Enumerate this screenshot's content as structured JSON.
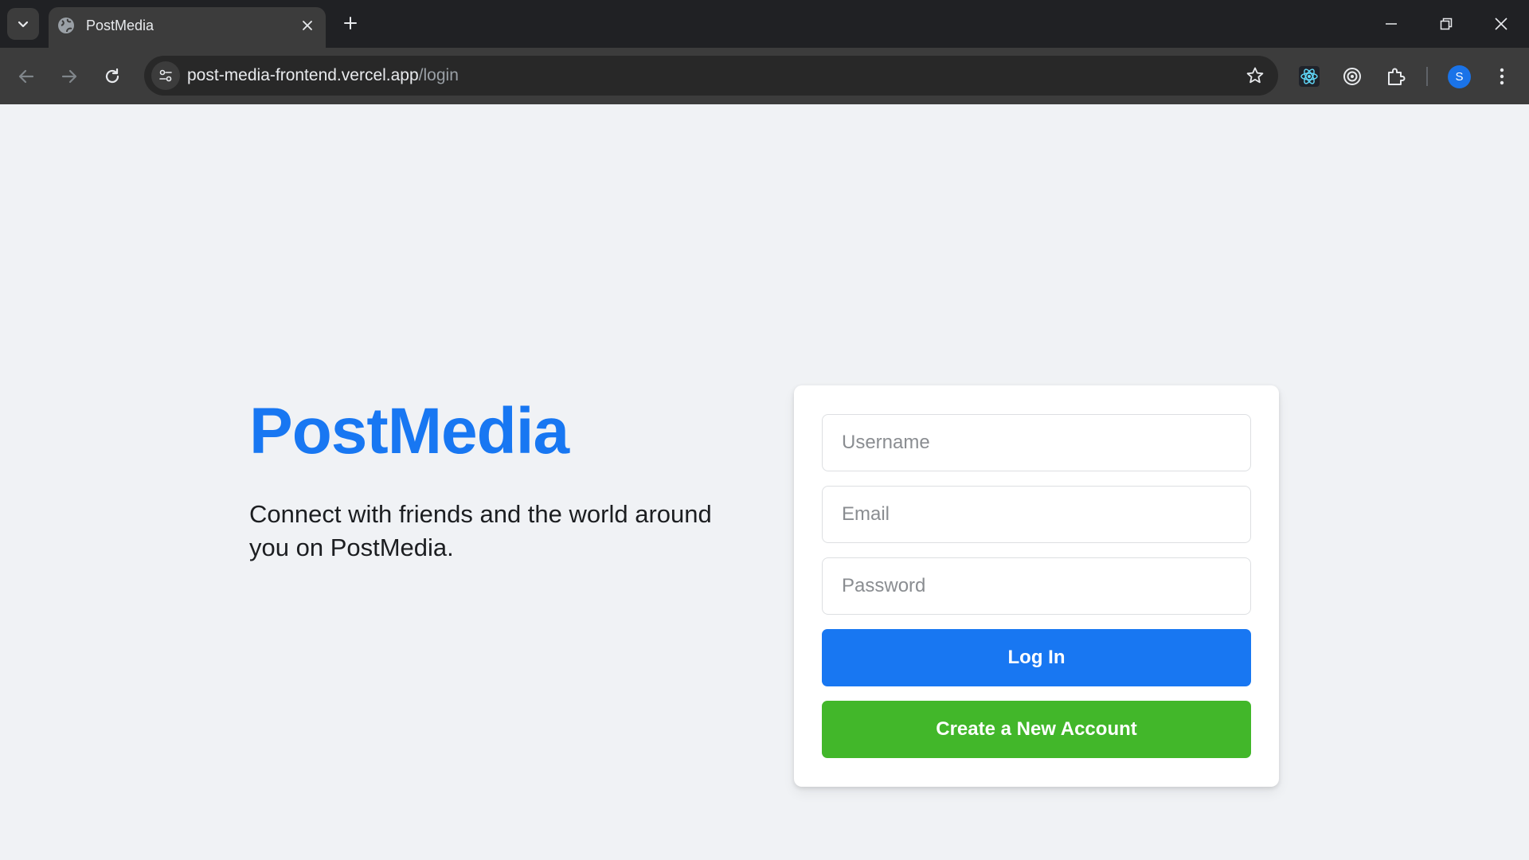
{
  "browser": {
    "tab": {
      "title": "PostMedia"
    },
    "address": {
      "domain": "post-media-frontend.vercel.app",
      "path": "/login"
    },
    "profile_initial": "S"
  },
  "brand": {
    "name": "PostMedia",
    "tagline": "Connect with friends and the world around you on PostMedia."
  },
  "login_form": {
    "username_placeholder": "Username",
    "email_placeholder": "Email",
    "password_placeholder": "Password",
    "login_label": "Log In",
    "create_account_label": "Create a New Account"
  },
  "colors": {
    "brand_blue": "#1877f2",
    "create_green": "#42b72a",
    "page_background": "#f0f2f5"
  },
  "icons": [
    "tab-search-icon",
    "globe-icon",
    "close-icon",
    "plus-icon",
    "minimize-icon",
    "restore-icon",
    "back-arrow-icon",
    "forward-arrow-icon",
    "reload-icon",
    "site-info-icon",
    "star-icon",
    "react-devtools-icon",
    "target-icon",
    "extensions-icon",
    "more-vert-icon"
  ]
}
